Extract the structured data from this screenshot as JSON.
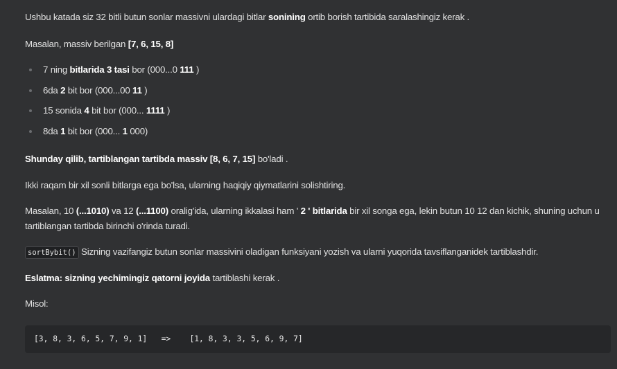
{
  "intro": {
    "part1": "Ushbu katada siz 32 bitli butun sonlar massivni ulardagi bitlar ",
    "bold": "sonining",
    "part2": " ortib borish tartibida saralashingiz kerak ."
  },
  "example": {
    "part1": "Masalan, massiv berilgan ",
    "bold": "[7, 6, 15, 8]"
  },
  "bullets": [
    {
      "a": "7 ning ",
      "b": "bitlarida 3 tasi",
      "c": " bor (000...0 ",
      "d": "111",
      "e": " )"
    },
    {
      "a": "6da ",
      "b": "2",
      "c": " bit bor (000...00 ",
      "d": "11",
      "e": " )"
    },
    {
      "a": "15 sonida ",
      "b": "4",
      "c": " bit bor (000... ",
      "d": "1111",
      "e": " )"
    },
    {
      "a": "8da ",
      "b": "1",
      "c": " bit bor (000... ",
      "d": "1",
      "e": " 000)"
    }
  ],
  "sorted": {
    "bold": "Shunday qilib, tartiblangan tartibda massiv [8, 6, 7, 15]",
    "rest": " bo'ladi ."
  },
  "tie_rule": "Ikki raqam bir xil sonli bitlarga ega bo'lsa, ularning haqiqiy qiymatlarini solishtiring.",
  "tie_example": {
    "p1": "Masalan, 10 ",
    "b1": "(...1010)",
    "p2": " va 12 ",
    "b2": "(...1100)",
    "p3": " oralig'ida, ularning ikkalasi ham ' ",
    "b3": "2 ' bitlarida",
    "p4": " bir xil songa ega, lekin butun 10 12 dan kichik, shuning uchun u",
    "line2": "tartiblangan tartibda birinchi o'rinda turadi."
  },
  "task": {
    "code": "sortBybit()",
    "text": " Sizning vazifangiz butun sonlar massivini oladigan funksiyani yozish va ularni yuqorida tavsiflanganidek tartiblashdir."
  },
  "note": {
    "bold": "Eslatma: sizning yechimingiz qatorni joyida",
    "rest": " tartiblashi kerak ."
  },
  "misol_label": "Misol:",
  "code_example": "[3, 8, 3, 6, 5, 7, 9, 1]   =>    [1, 8, 3, 3, 5, 6, 9, 7]"
}
